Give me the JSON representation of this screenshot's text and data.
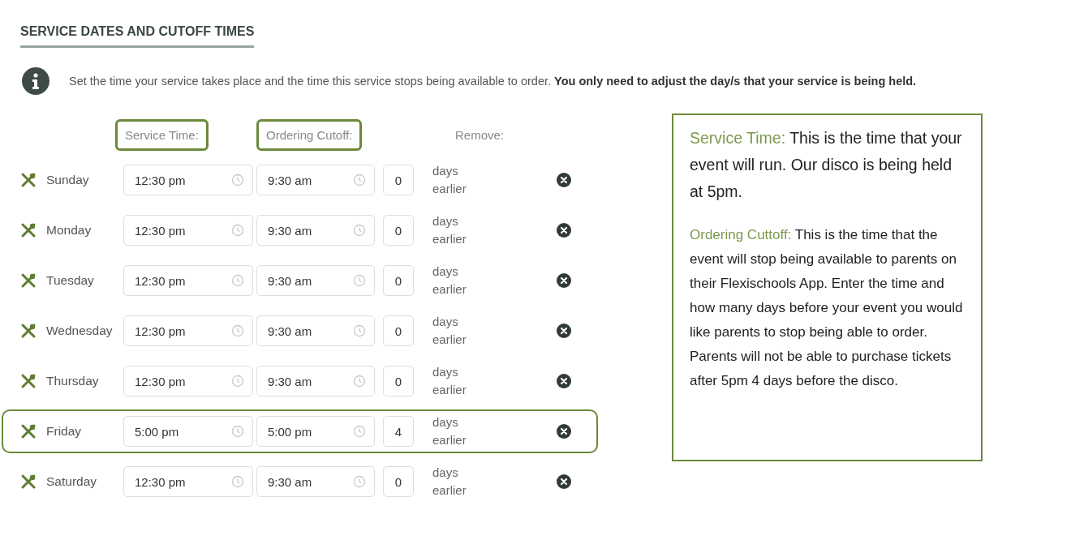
{
  "section": {
    "title": "SERVICE DATES AND CUTOFF TIMES"
  },
  "info": {
    "text": "Set the time your service takes place and the time this service stops being available to order. **You only need to adjust the day/s that your service is being held.**"
  },
  "columns": [
    {
      "kind": "service",
      "label": "Service Time:",
      "highlighted": true
    },
    {
      "kind": "cutoff",
      "label": "Ordering Cutoff:",
      "highlighted": true
    },
    {
      "kind": "remove",
      "label": "Remove:",
      "highlighted": false
    }
  ],
  "days": [
    {
      "day": "Sunday",
      "service_time": "12:30 pm",
      "cutoff_time": "9:30 am",
      "days_before": "0",
      "unit": "days earlier",
      "highlighted": false
    },
    {
      "day": "Monday",
      "service_time": "12:30 pm",
      "cutoff_time": "9:30 am",
      "days_before": "0",
      "unit": "days earlier",
      "highlighted": false
    },
    {
      "day": "Tuesday",
      "service_time": "12:30 pm",
      "cutoff_time": "9:30 am",
      "days_before": "0",
      "unit": "days earlier",
      "highlighted": false
    },
    {
      "day": "Wednesday",
      "service_time": "12:30 pm",
      "cutoff_time": "9:30 am",
      "days_before": "0",
      "unit": "days earlier",
      "highlighted": false
    },
    {
      "day": "Thursday",
      "service_time": "12:30 pm",
      "cutoff_time": "9:30 am",
      "days_before": "0",
      "unit": "days earlier",
      "highlighted": false
    },
    {
      "day": "Friday",
      "service_time": "5:00 pm",
      "cutoff_time": "5:00 pm",
      "days_before": "4",
      "unit": "days earlier",
      "highlighted": true
    },
    {
      "day": "Saturday",
      "service_time": "12:30 pm",
      "cutoff_time": "9:30 am",
      "days_before": "0",
      "unit": "days earlier",
      "highlighted": false
    }
  ],
  "callout": {
    "paragraphs": [
      {
        "kind": "large",
        "term": "Service Time:",
        "text": "This is the time that your event will run. Our disco is being held at 5pm."
      },
      {
        "kind": "small",
        "term": "Ordering Cuttoff:",
        "text": "This is the time that the event will stop being available to parents on their Flexischools App. Enter the time and how many days before your event you would like parents to stop being able to order. Parents will not be able to purchase tickets after 5pm 4 days before the disco."
      }
    ]
  }
}
